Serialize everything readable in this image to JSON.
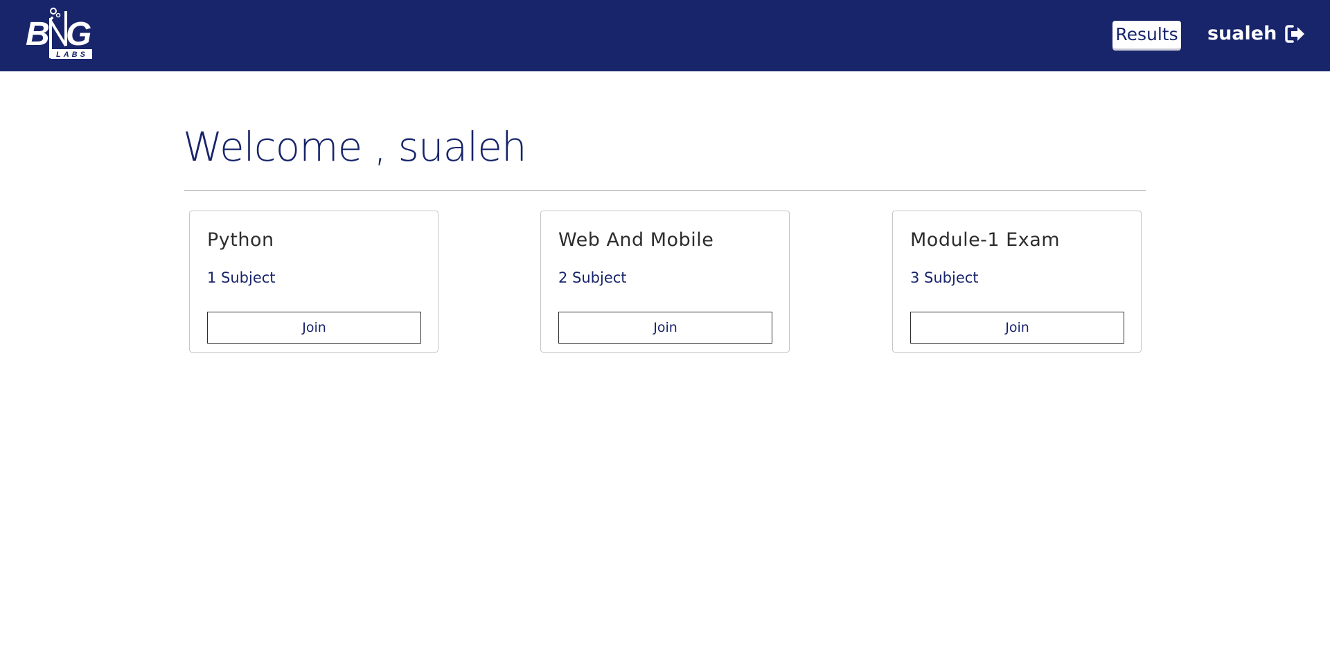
{
  "navbar": {
    "logo_text": "BNG",
    "logo_subtext": "LABS",
    "results_label": "Results",
    "username": "sualeh",
    "logout_icon": "sign-out-icon"
  },
  "main": {
    "welcome_text": "Welcome , sualeh",
    "cards": [
      {
        "title": "Python",
        "subtitle": "1 Subject",
        "button_label": "Join"
      },
      {
        "title": "Web And Mobile",
        "subtitle": "2 Subject",
        "button_label": "Join"
      },
      {
        "title": "Module-1 Exam",
        "subtitle": "3 Subject",
        "button_label": "Join"
      }
    ]
  },
  "colors": {
    "brand": "#18256b",
    "white": "#ffffff",
    "card_border": "#c6c6c6",
    "text_dark": "#2d2d2d"
  }
}
